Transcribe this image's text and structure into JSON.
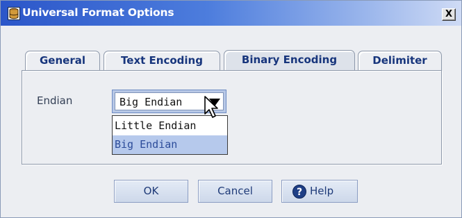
{
  "window": {
    "title": "Universal Format Options",
    "close_label": "X"
  },
  "tabs": [
    {
      "label": "General",
      "active": false
    },
    {
      "label": "Text Encoding",
      "active": false
    },
    {
      "label": "Binary Encoding",
      "active": true
    },
    {
      "label": "Delimiter",
      "active": false
    }
  ],
  "endian": {
    "label": "Endian",
    "selected_value": "Big Endian",
    "options": [
      "Little Endian",
      "Big Endian"
    ],
    "highlighted_option": "Big Endian"
  },
  "buttons": {
    "ok": "OK",
    "cancel": "Cancel",
    "help": "Help"
  },
  "icons": {
    "app": "database-icon",
    "help": "help-circle-icon",
    "dropdown": "chevron-down-icon",
    "cursor": "mouse-pointer-icon"
  },
  "colors": {
    "titlebar_start": "#2b56c9",
    "titlebar_end": "#cfdbf5",
    "tab_text": "#17357c",
    "selection": "#b6c9ec",
    "button_bg": "#d6e0f0"
  }
}
